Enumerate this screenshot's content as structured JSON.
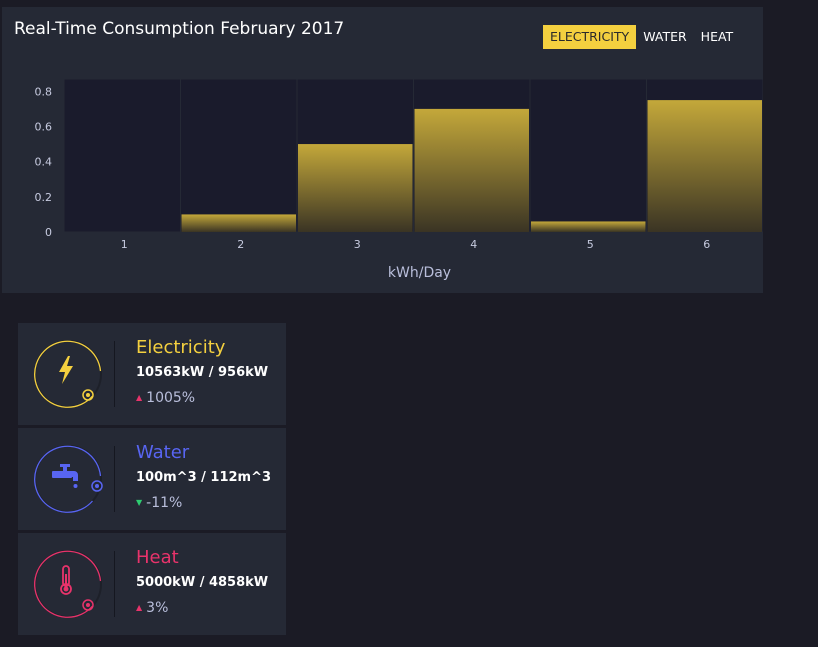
{
  "chart": {
    "title": "Real-Time Consumption February 2017",
    "tabs": [
      {
        "label": "ELECTRICITY",
        "active": true
      },
      {
        "label": "WATER",
        "active": false
      },
      {
        "label": "HEAT",
        "active": false
      }
    ]
  },
  "chart_data": {
    "type": "bar",
    "categories": [
      "1",
      "2",
      "3",
      "4",
      "5",
      "6"
    ],
    "values": [
      0,
      0.1,
      0.5,
      0.7,
      0.06,
      0.75
    ],
    "xlabel": "kWh/Day",
    "ylabel": "",
    "yticks": [
      "0",
      "0.2",
      "0.4",
      "0.6",
      "0.8"
    ],
    "ylim": [
      0,
      0.8
    ],
    "grid": false,
    "bar_color": "#f4d03f"
  },
  "summaries": [
    {
      "title": "Electricity",
      "values": "10563kW / 956kW",
      "change": "1005%",
      "trend": "up",
      "color": "#f4d03f",
      "trend_color": "#e8336b",
      "icon": "lightning-icon",
      "arrow": "▲"
    },
    {
      "title": "Water",
      "values": "100m^3 / 112m^3",
      "change": "-11%",
      "trend": "down",
      "color": "#5865f2",
      "trend_color": "#2ecc71",
      "icon": "faucet-icon",
      "arrow": "▼"
    },
    {
      "title": "Heat",
      "values": "5000kW / 4858kW",
      "change": "3%",
      "trend": "up",
      "color": "#e8336b",
      "trend_color": "#e8336b",
      "icon": "thermometer-icon",
      "arrow": "▲"
    }
  ]
}
